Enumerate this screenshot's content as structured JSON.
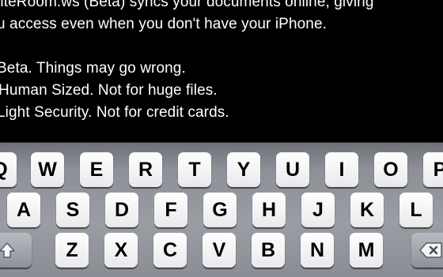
{
  "document": {
    "lines": [
      "riteRoom.ws (Beta) syncs your documents online, giving",
      "u access even when you don't have your iPhone.",
      "",
      "Beta. Things may go wrong.",
      "Human Sized. Not for huge files.",
      "Light Security. Not for credit cards."
    ]
  },
  "keyboard": {
    "row1": [
      "Q",
      "W",
      "E",
      "R",
      "T",
      "Y",
      "U",
      "I",
      "O",
      "P"
    ],
    "row2": [
      "A",
      "S",
      "D",
      "F",
      "G",
      "H",
      "J",
      "K",
      "L"
    ],
    "row3": [
      "Z",
      "X",
      "C",
      "V",
      "B",
      "N",
      "M"
    ],
    "shift_icon": "shift-arrow-icon",
    "delete_icon": "backspace-icon"
  }
}
